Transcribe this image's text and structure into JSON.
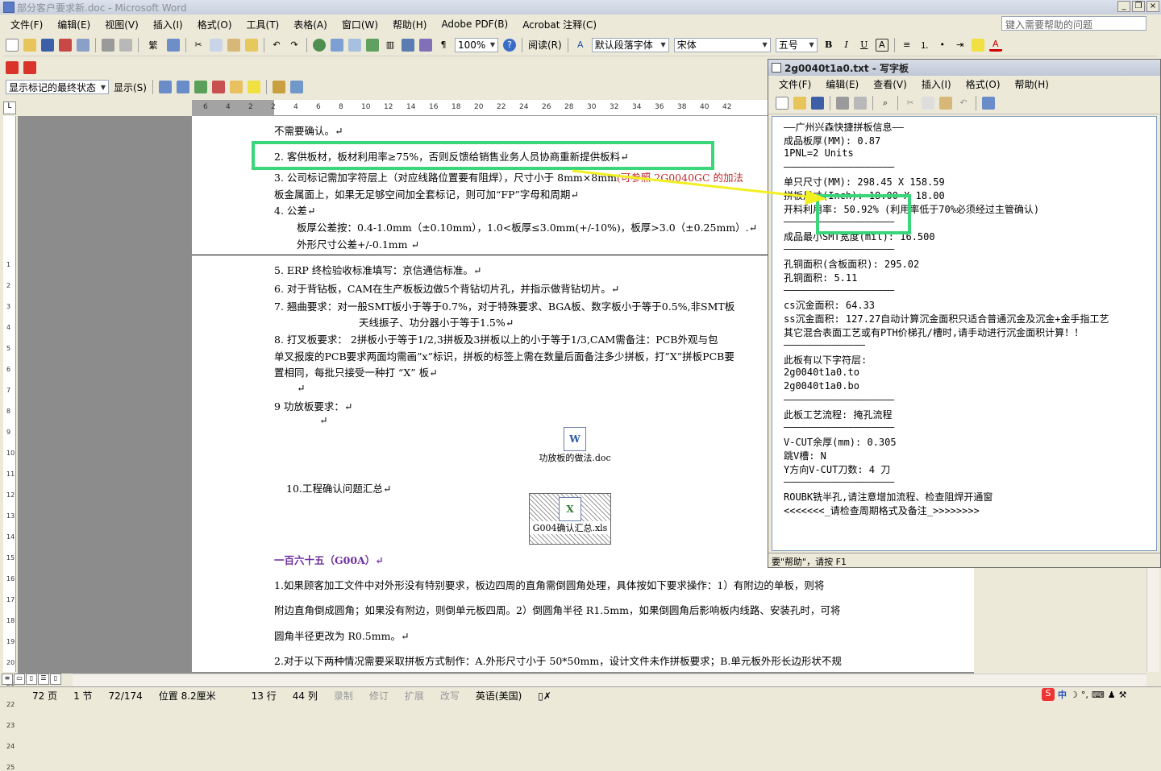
{
  "window": {
    "title": "部分客户要求新.doc - Microsoft Word"
  },
  "menu": [
    "文件(F)",
    "编辑(E)",
    "视图(V)",
    "插入(I)",
    "格式(O)",
    "工具(T)",
    "表格(A)",
    "窗口(W)",
    "帮助(H)",
    "Adobe PDF(B)",
    "Acrobat 注释(C)"
  ],
  "help_placeholder": "键入需要帮助的问题",
  "toolbar": {
    "zoom": "100%",
    "read_label": "阅读(R)",
    "style": "默认段落字体",
    "font": "宋体",
    "size": "五号",
    "bold": "B",
    "italic": "I",
    "underline": "U"
  },
  "review_toolbar": {
    "markup_mode": "显示标记的最终状态",
    "show_label": "显示(S)"
  },
  "ruler": {
    "h_ticks": [
      "6",
      "4",
      "2",
      "2",
      "4",
      "6",
      "8",
      "10",
      "12",
      "14",
      "16",
      "18",
      "20",
      "22",
      "24",
      "26",
      "28",
      "30",
      "32",
      "34",
      "36",
      "38",
      "40",
      "42"
    ],
    "v_ticks": [
      "1",
      "2",
      "3",
      "4",
      "5",
      "6",
      "7",
      "8",
      "9",
      "10",
      "11",
      "12",
      "13",
      "14",
      "15",
      "16",
      "17",
      "18",
      "19",
      "20",
      "21",
      "22",
      "23",
      "24",
      "25"
    ]
  },
  "document": {
    "lines": [
      "不需要确认。↵",
      "2.      客供板材，板材利用率≥75%，否则反馈给销售业务人员协商重新提供板料↵",
      "3. 公司标记需加字符层上（对应线路位置要有阻焊），尺寸小于 8mm×8mm",
      "(可参照 2G0040GC 的加法",
      "板金属面上，如果无足够空间加全套标记，则可加“FP”字母和周期↵",
      "4.   公差↵",
      "板厚公差按：0.4-1.0mm（±0.10mm），1.0<板厚≤3.0mm(+/-10%)，板厚>3.0（±0.25mm）.↵",
      "外形尺寸公差+/-0.1mm ↵",
      "5.   ERP 终检验收标准填写：京信通信标准。↵",
      "6.    对于背钻板，CAM在生产板板边做5个背钻切片孔，并指示做背钻切片。↵",
      "7.    翘曲要求：对一般SMT板小于等于0.7%，对于特殊要求、BGA板、数字板小于等于0.5%,非SMT板",
      "天线振子、功分器小于等于1.5%↵",
      "8.    打叉板要求：  2拼板小于等于1/2,3拼板及3拼板以上的小于等于1/3,CAM需备注：PCB外观与包",
      "单叉报废的PCB要求两面均需画”x”标识，拼板的标签上需在数量后面备注多少拼板，打”X”拼板PCB要",
      "置相同，每批只接受一种打 “X” 板↵",
      "↵",
      "9 功放板要求：↵",
      "↵",
      "功放板的做法.doc",
      "10.工程确认问题汇总↵",
      "G004确认汇总.xls",
      "一百六十五（G00A）↵",
      "1.如果顾客加工文件中对外形没有特别要求，板边四周的直角需倒圆角处理，具体按如下要求操作：1）有附边的单板，则将",
      "附边直角倒成圆角；如果没有附边，则倒单元板四周。2）倒圆角半径 R1.5mm，如果倒圆角后影响板内线路、安装孔时，可将",
      "圆角半径更改为 R0.5mm。↵",
      "2.对于以下两种情况需要采取拼板方式制作：A.外形尺寸小于 50*50mm，设计文件未作拼板要求；B.单元板外形长边形状不规"
    ]
  },
  "notepad": {
    "title": "2g0040t1a0.txt - 写字板",
    "menu": [
      "文件(F)",
      "编辑(E)",
      "查看(V)",
      "插入(I)",
      "格式(O)",
      "帮助(H)"
    ],
    "lines": [
      "——广州兴森快捷拼板信息——",
      "成品板厚(MM): 0.87",
      "1PNL=2 Units",
      "———————————————————",
      "单只尺寸(MM): 298.45 X 158.59",
      "拼板尺寸(Inch): 18.00 X 18.00",
      "开料利用率: 50.92% (利用率低于70%必须经过主管确认)",
      "———————————————————",
      "成品最小SMT宽度(mil): 16.500",
      "———————————————————",
      "孔铜面积(含板面积): 295.02",
      "孔铜面积: 5.11",
      "———————————————————",
      "cs沉金面积: 64.33",
      "ss沉金面积: 127.27自动计算沉金面积只适合普通沉金及沉金+金手指工艺",
      "其它混合表面工艺或有PTH价梯孔/槽时,请手动进行沉金面积计算！！",
      "——————————————",
      "此板有以下字符层:",
      "2g0040t1a0.to",
      "2g0040t1a0.bo",
      "———————————————————",
      "此板工艺流程: 掩孔流程",
      "———————————————————",
      "V-CUT余厚(mm): 0.305",
      "跳V槽: N",
      "Y方向V-CUT刀数: 4 刀",
      "———————————————————",
      "ROUBK铣半孔,请注意增加流程、检查阻焊开通窗",
      "<<<<<<<_请检查周期格式及备注_>>>>>>>>"
    ],
    "status": "要\"帮助\"，请按 F1"
  },
  "statusbar": {
    "page": "72 页",
    "section": "1 节",
    "pages": "72/174",
    "position": "位置 8.2厘米",
    "row": "13 行",
    "col": "44 列",
    "rec": "录制",
    "trk": "修订",
    "ext": "扩展",
    "ovr": "改写",
    "lang": "英语(美国)"
  },
  "ime": {
    "lang": "中"
  }
}
